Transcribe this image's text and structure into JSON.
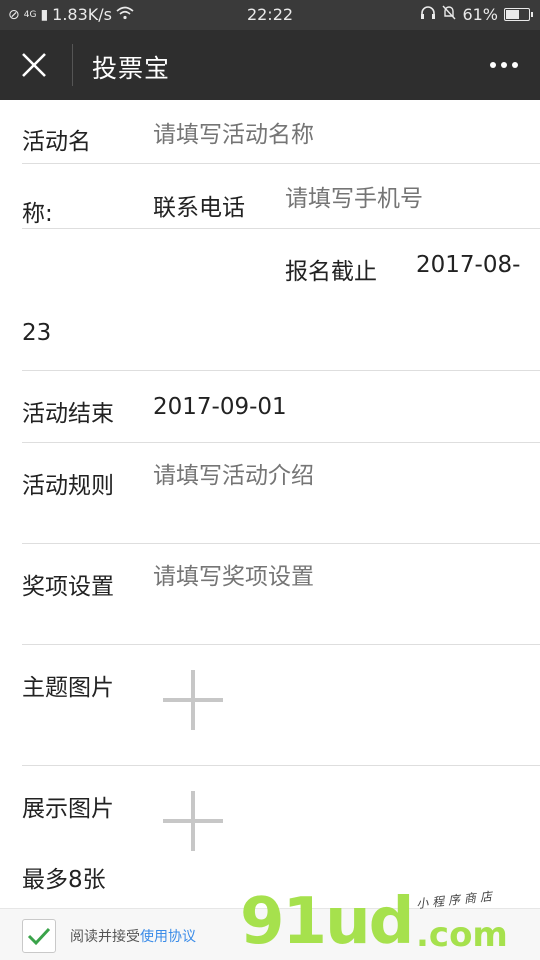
{
  "status_bar": {
    "network": "4G",
    "speed": "1.83K/s",
    "time": "22:22",
    "battery": "61%",
    "battery_level": 0.61
  },
  "navbar": {
    "title": "投票宝",
    "close_icon": "close-icon",
    "more_icon": "more-icon"
  },
  "form": {
    "activity_name": {
      "label": "活动名",
      "placeholder": "请填写活动名称"
    },
    "row2": {
      "label": "称:",
      "contact_label": "联系电话",
      "contact_placeholder": "请填写手机号"
    },
    "deadline": {
      "label": "报名截止",
      "value_part1": "2017-08-",
      "value_part2": "23"
    },
    "end": {
      "label": "活动结束",
      "value": "2017-09-01"
    },
    "rules": {
      "label": "活动规则",
      "placeholder": "请填写活动介绍"
    },
    "awards": {
      "label": "奖项设置",
      "placeholder": "请填写奖项设置"
    },
    "theme_image": {
      "label": "主题图片"
    },
    "display_image": {
      "label": "展示图片",
      "note": "最多8张"
    }
  },
  "footer": {
    "agree_text": "阅读并接受",
    "agree_link": "使用协议",
    "checked": true
  },
  "watermark": {
    "big": "91ud",
    "com": ".com",
    "small": "小程序商店"
  },
  "colors": {
    "navbar": "#2e2e2e",
    "statusbar": "#3a3a3a",
    "link": "#3b8ce8",
    "check": "#3aa34a",
    "watermark": "#a6e14d"
  }
}
